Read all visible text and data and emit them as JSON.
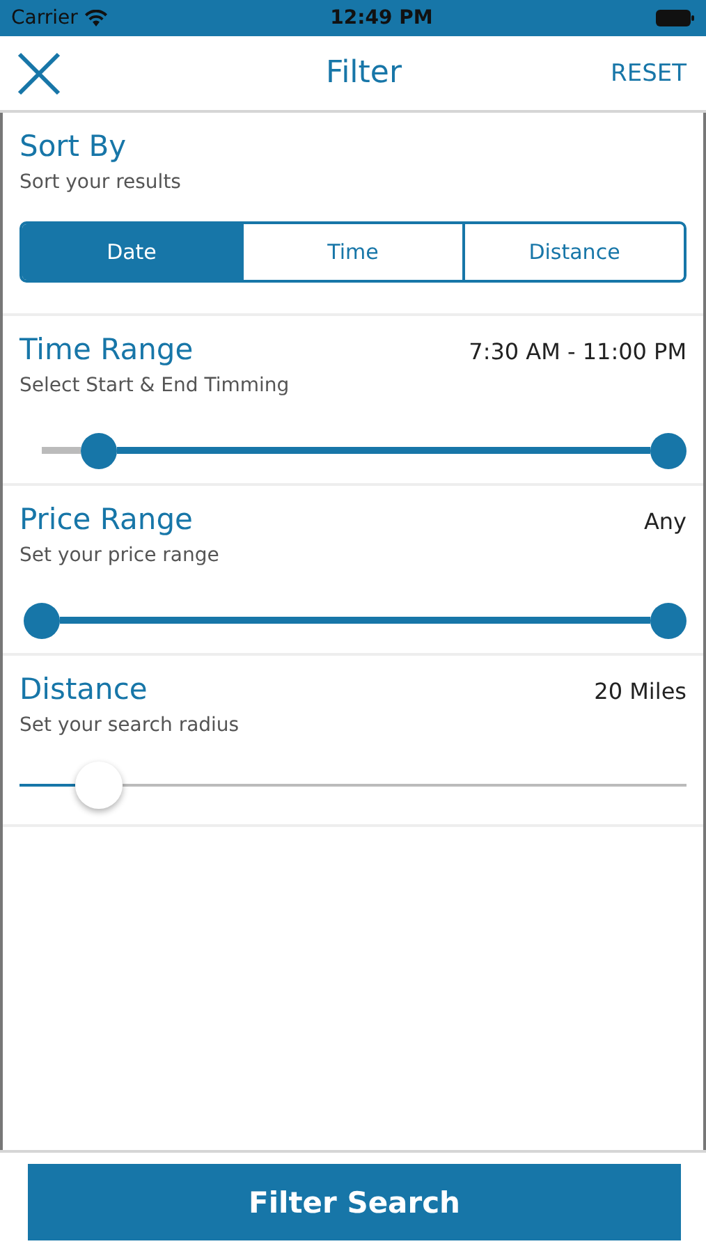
{
  "status_bar": {
    "carrier": "Carrier",
    "time": "12:49 PM"
  },
  "header": {
    "title": "Filter",
    "reset": "RESET"
  },
  "sort": {
    "title": "Sort By",
    "subtitle": "Sort your results",
    "options": [
      {
        "label": "Date",
        "selected": true
      },
      {
        "label": "Time",
        "selected": false
      },
      {
        "label": "Distance",
        "selected": false
      }
    ]
  },
  "filters": [
    {
      "kind": "range",
      "title": "Time Range",
      "subtitle": "Select Start & End Timming",
      "value": "7:30 AM - 11:00 PM",
      "handles": [
        {
          "level": 0.09
        },
        {
          "level": 1
        }
      ]
    },
    {
      "kind": "range",
      "title": "Price Range",
      "subtitle": "Set your price range",
      "value": "Any",
      "handles": [
        {
          "level": 0
        },
        {
          "level": 1
        }
      ]
    },
    {
      "kind": "single",
      "title": "Distance",
      "subtitle": "Set your search radius",
      "value": "20 Miles",
      "level": 0.12
    }
  ],
  "submit": "Filter Search"
}
